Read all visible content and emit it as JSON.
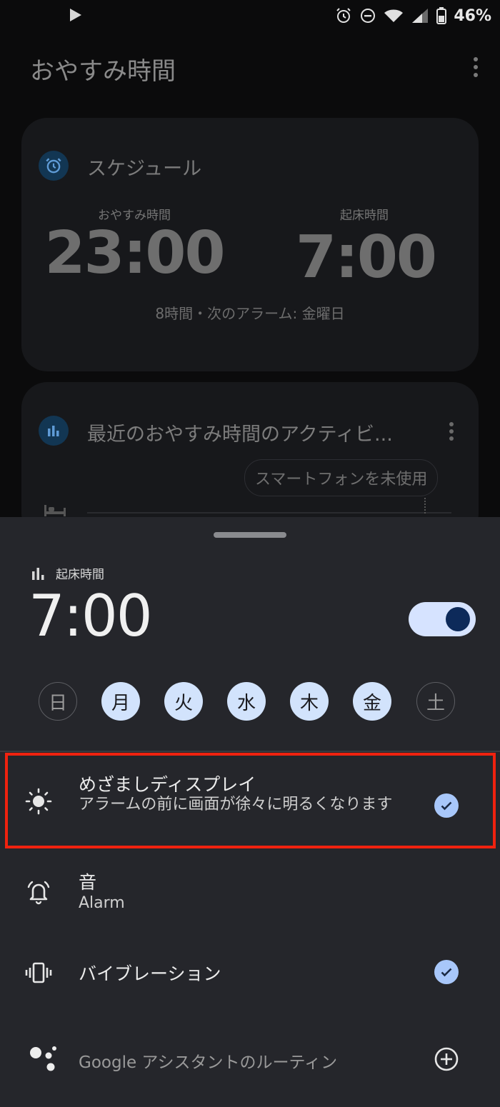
{
  "status": {
    "battery": "46%"
  },
  "app": {
    "title": "おやすみ時間",
    "schedule_card": {
      "title": "スケジュール",
      "bedtime_label": "おやすみ時間",
      "bedtime": "23:00",
      "wake_label": "起床時間",
      "wake": "7:00",
      "summary": "8時間・次のアラーム: 金曜日"
    },
    "activity_card": {
      "title": "最近のおやすみ時間のアクティビ...",
      "chip": "スマートフォンを未使用"
    }
  },
  "sheet": {
    "label": "起床時間",
    "time": "7:00",
    "toggle_on": true,
    "days": [
      {
        "label": "日",
        "selected": false
      },
      {
        "label": "月",
        "selected": true
      },
      {
        "label": "火",
        "selected": true
      },
      {
        "label": "水",
        "selected": true
      },
      {
        "label": "木",
        "selected": true
      },
      {
        "label": "金",
        "selected": true
      },
      {
        "label": "土",
        "selected": false
      }
    ],
    "options": {
      "sunrise": {
        "title": "めざましディスプレイ",
        "desc": "アラームの前に画面が徐々に明るくなります",
        "checked": true
      },
      "sound": {
        "title": "音",
        "desc": "Alarm"
      },
      "vibration": {
        "title": "バイブレーション",
        "checked": true
      },
      "assistant": {
        "title": "Google アシスタントのルーティン"
      }
    }
  },
  "colors": {
    "accent": "#a8c7fa",
    "highlight": "#f0220f",
    "toggle_track": "#d6e3ff"
  }
}
